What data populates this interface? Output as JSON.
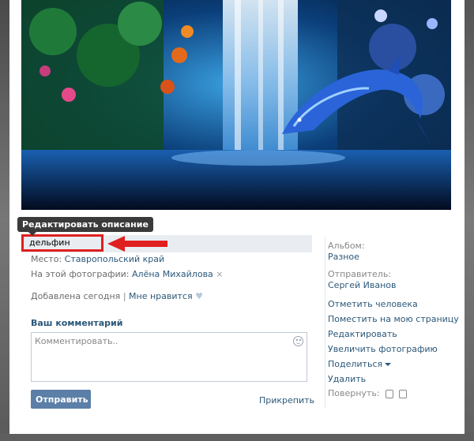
{
  "tooltip": "Редактировать описание",
  "description": "дельфин",
  "meta": {
    "place_label": "Место:",
    "place_value": "Ставропольский край",
    "tagged_label": "На этой фотографии:",
    "tagged_value": "Алёна Михайлова",
    "remove_tag": "×",
    "added": "Добавлена сегодня",
    "separator": "|",
    "like": "Мне нравится",
    "heart": "♥"
  },
  "comment": {
    "title": "Ваш комментарий",
    "placeholder": "Комментировать..",
    "send": "Отправить",
    "attach": "Прикрепить"
  },
  "sidebar": {
    "album_label": "Альбом:",
    "album_value": "Разное",
    "sender_label": "Отправитель:",
    "sender_value": "Сергей Иванов",
    "actions": [
      "Отметить человека",
      "Поместить на мою страницу",
      "Редактировать",
      "Увеличить фотографию",
      "Поделиться",
      "Удалить"
    ],
    "rotate_label": "Повернуть:"
  },
  "colors": {
    "link": "#2b587a",
    "highlight": "#e01f1f",
    "button": "#5b7fa6"
  }
}
